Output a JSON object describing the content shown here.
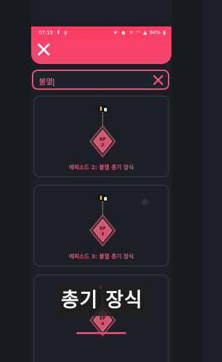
{
  "status_bar": {
    "time": "07:19",
    "battery": "94%"
  },
  "search": {
    "query": "불멸"
  },
  "results": [
    {
      "label": "에피소드 2: 불멸 총기 장식",
      "ep": "EP 2"
    },
    {
      "label": "에피소드 3: 불멸 총기 장식",
      "ep": "EP 3"
    },
    {
      "label": "",
      "ep": "EP 4"
    }
  ],
  "caption": "총기 장식",
  "colors": {
    "accent": "#ff3c64",
    "label": "#d7587a",
    "background": "#1b1f25"
  }
}
